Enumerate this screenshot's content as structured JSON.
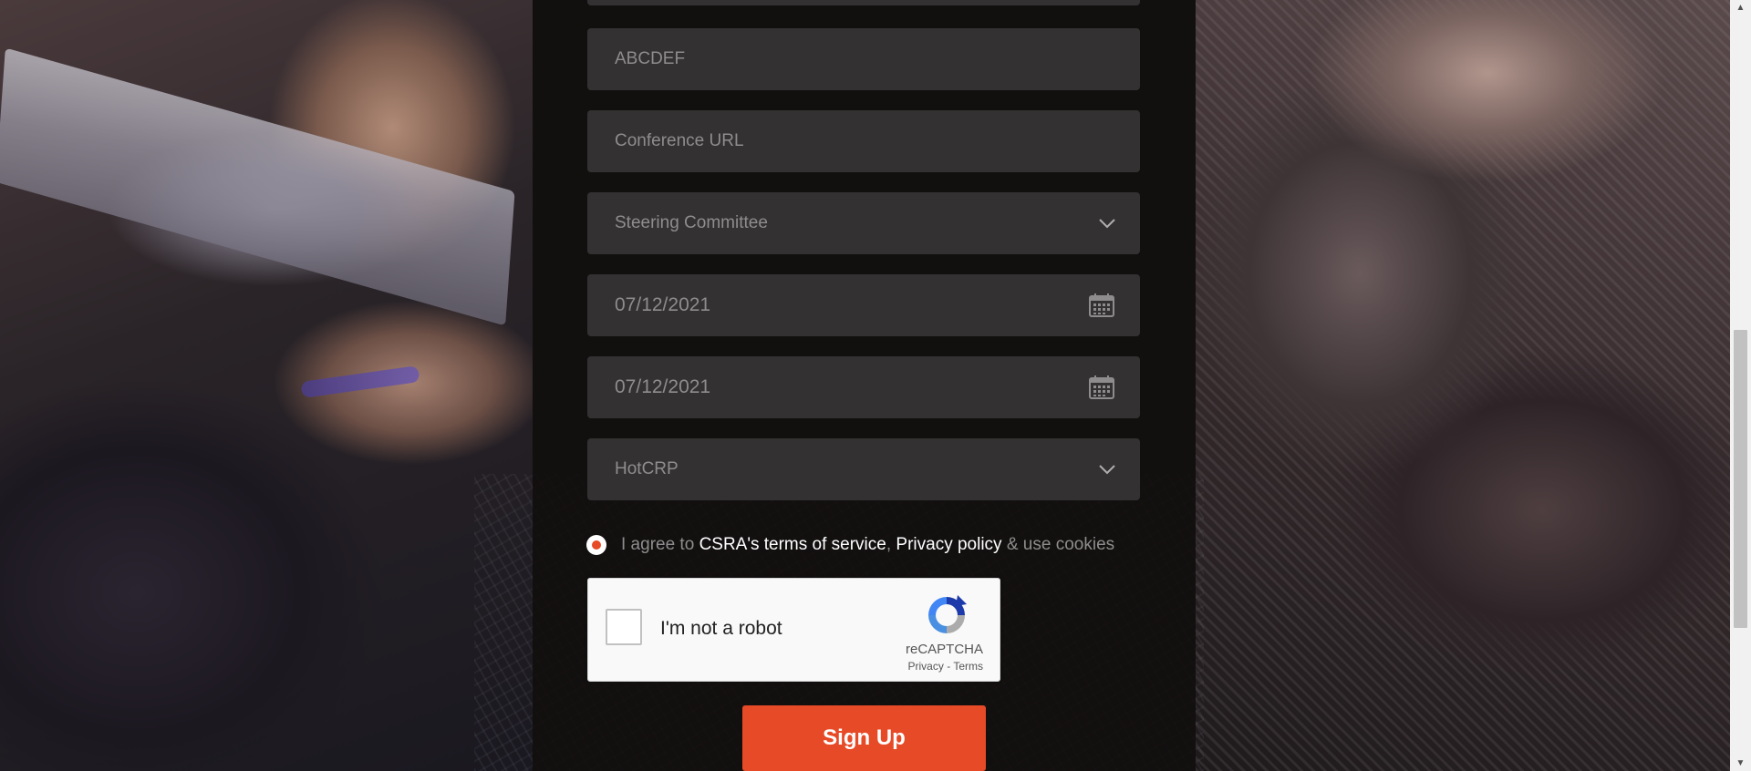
{
  "form": {
    "fields": [
      {
        "id": "partial-top",
        "value": ""
      },
      {
        "id": "acronym",
        "value": "ABCDEF"
      },
      {
        "id": "conference-url",
        "placeholder": "Conference URL"
      },
      {
        "id": "committee",
        "value": "Steering Committee",
        "kind": "select"
      },
      {
        "id": "start-date",
        "value": "07/12/2021",
        "kind": "date"
      },
      {
        "id": "end-date",
        "value": "07/12/2021",
        "kind": "date"
      },
      {
        "id": "system",
        "value": "HotCRP",
        "kind": "select"
      }
    ],
    "agree": {
      "prefix": "I agree to",
      "tos_link": "CSRA's terms of service",
      "comma": ",",
      "privacy_link": "Privacy policy",
      "suffix": "& use cookies",
      "checked": true
    },
    "recaptcha": {
      "label": "I'm not a robot",
      "brand": "reCAPTCHA",
      "privacy": "Privacy",
      "dash": "-",
      "terms": "Terms"
    },
    "submit_label": "Sign Up"
  },
  "colors": {
    "accent": "#e64a26",
    "field_bg": "#333131",
    "panel_bg": "rgba(18,14,14,0.86)"
  },
  "icons": {
    "select": "chevron-down-icon",
    "date": "calendar-icon",
    "recaptcha": "recaptcha-logo-icon"
  }
}
